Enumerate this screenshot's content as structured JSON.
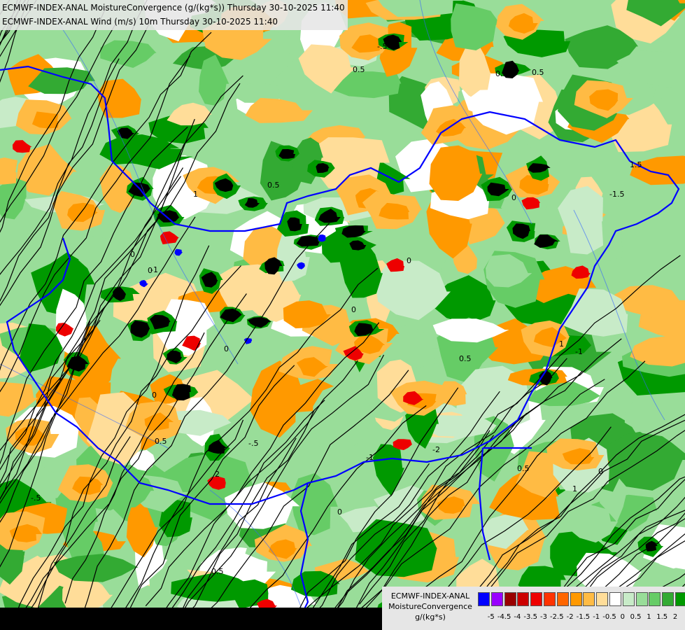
{
  "header": {
    "line1": "ECMWF-INDEX-ANAL MoistureConvergence (g/(kg*s)) Thursday 30-10-2025 11:40",
    "line2": "ECMWF-INDEX-ANAL Wind (m/s) 10m Thursday 30-10-2025 11:40"
  },
  "legend": {
    "line1": "ECMWF-INDEX-ANAL",
    "line2": "MoistureConvergence",
    "line3": "g/(kg*s)",
    "colors": [
      "#0000ff",
      "#9900ff",
      "#990000",
      "#cc0000",
      "#ee0000",
      "#ff3300",
      "#ff6600",
      "#ff9900",
      "#ffbb44",
      "#ffdd99",
      "#ffffff",
      "#c8ebc8",
      "#99dd99",
      "#66cc66",
      "#33aa33",
      "#009900"
    ],
    "ticks": [
      "-5",
      "-4.5",
      "-4",
      "-3.5",
      "-3",
      "-2.5",
      "-2",
      "-1.5",
      "-1",
      "-0.5",
      "0",
      "0.5",
      "1",
      "1.5",
      "2"
    ]
  },
  "map": {
    "field_colors": {
      "black": "#000000",
      "dark_green": "#009900",
      "green": "#33aa33",
      "mid_green": "#66cc66",
      "light_green": "#99dd99",
      "pale_green": "#c8ebc8",
      "white": "#ffffff",
      "pale_orange": "#ffdd99",
      "light_orange": "#ffbb44",
      "orange": "#ff9900",
      "red": "#ee0000",
      "blue": "#0000ff"
    },
    "border_color": "#0000ff",
    "river_color": "#3366ff",
    "contour_labels": [
      "-.5",
      "0",
      "0",
      "0",
      "0",
      "0",
      "0",
      "0",
      "0",
      "0",
      "0.5",
      "0.5",
      "0.5",
      "0.5",
      "0.5",
      "0.5",
      "0.5",
      "0.5",
      "-1",
      "-1",
      "-1",
      "-.5",
      "-.5",
      "-1.5",
      "1",
      "1",
      "1",
      "1.5",
      "2",
      "-2"
    ]
  }
}
